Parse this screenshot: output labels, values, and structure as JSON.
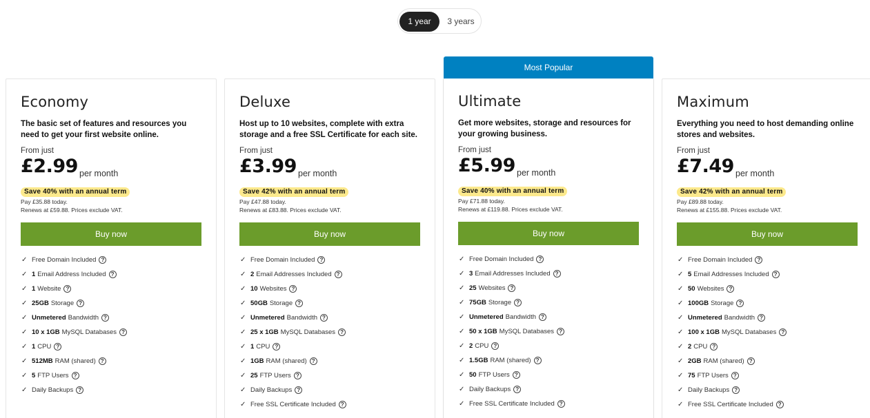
{
  "term_toggle": {
    "option_1": "1 year",
    "option_2": "3 years"
  },
  "popular_label": "Most Popular",
  "plans": [
    {
      "name": "Economy",
      "description": "The basic set of features and resources you need to get your first website online.",
      "from_label": "From just",
      "price": "£2.99",
      "per": "per month",
      "save": "Save 40% with an annual term",
      "pay_today": "Pay £35.88 today.",
      "renews": "Renews at £59.88. Prices exclude VAT.",
      "buy": "Buy now",
      "features": [
        {
          "bold": "",
          "text": "Free Domain Included"
        },
        {
          "bold": "1",
          "text": "Email Address Included"
        },
        {
          "bold": "1",
          "text": "Website"
        },
        {
          "bold": "25GB",
          "text": "Storage"
        },
        {
          "bold": "Unmetered",
          "text": "Bandwidth"
        },
        {
          "bold": "10 x 1GB",
          "text": "MySQL Databases"
        },
        {
          "bold": "1",
          "text": "CPU"
        },
        {
          "bold": "512MB",
          "text": "RAM (shared)"
        },
        {
          "bold": "5",
          "text": "FTP Users"
        },
        {
          "bold": "",
          "text": "Daily Backups"
        }
      ]
    },
    {
      "name": "Deluxe",
      "description": "Host up to 10 websites, complete with extra storage and a free SSL Certificate for each site.",
      "from_label": "From just",
      "price": "£3.99",
      "per": "per month",
      "save": "Save 42% with an annual term",
      "pay_today": "Pay £47.88 today.",
      "renews": "Renews at £83.88. Prices exclude VAT.",
      "buy": "Buy now",
      "features": [
        {
          "bold": "",
          "text": "Free Domain Included"
        },
        {
          "bold": "2",
          "text": "Email Addresses Included"
        },
        {
          "bold": "10",
          "text": "Websites"
        },
        {
          "bold": "50GB",
          "text": "Storage"
        },
        {
          "bold": "Unmetered",
          "text": "Bandwidth"
        },
        {
          "bold": "25 x 1GB",
          "text": "MySQL Databases"
        },
        {
          "bold": "1",
          "text": "CPU"
        },
        {
          "bold": "1GB",
          "text": "RAM (shared)"
        },
        {
          "bold": "25",
          "text": "FTP Users"
        },
        {
          "bold": "",
          "text": "Daily Backups"
        },
        {
          "bold": "",
          "text": "Free SSL Certificate Included"
        }
      ]
    },
    {
      "name": "Ultimate",
      "description": "Get more websites, storage and resources for your growing business.",
      "from_label": "From just",
      "price": "£5.99",
      "per": "per month",
      "save": "Save 40% with an annual term",
      "pay_today": "Pay £71.88 today.",
      "renews": "Renews at £119.88. Prices exclude VAT.",
      "buy": "Buy now",
      "features": [
        {
          "bold": "",
          "text": "Free Domain Included"
        },
        {
          "bold": "3",
          "text": "Email Addresses Included"
        },
        {
          "bold": "25",
          "text": "Websites"
        },
        {
          "bold": "75GB",
          "text": "Storage"
        },
        {
          "bold": "Unmetered",
          "text": "Bandwidth"
        },
        {
          "bold": "50 x 1GB",
          "text": "MySQL Databases"
        },
        {
          "bold": "2",
          "text": "CPU"
        },
        {
          "bold": "1.5GB",
          "text": "RAM (shared)"
        },
        {
          "bold": "50",
          "text": "FTP Users"
        },
        {
          "bold": "",
          "text": "Daily Backups"
        },
        {
          "bold": "",
          "text": "Free SSL Certificate Included"
        }
      ]
    },
    {
      "name": "Maximum",
      "description": "Everything you need to host demanding online stores and websites.",
      "from_label": "From just",
      "price": "£7.49",
      "per": "per month",
      "save": "Save 42% with an annual term",
      "pay_today": "Pay £89.88 today.",
      "renews": "Renews at £155.88. Prices exclude VAT.",
      "buy": "Buy now",
      "features": [
        {
          "bold": "",
          "text": "Free Domain Included"
        },
        {
          "bold": "5",
          "text": "Email Addresses Included"
        },
        {
          "bold": "50",
          "text": "Websites"
        },
        {
          "bold": "100GB",
          "text": "Storage"
        },
        {
          "bold": "Unmetered",
          "text": "Bandwidth"
        },
        {
          "bold": "100 x 1GB",
          "text": "MySQL Databases"
        },
        {
          "bold": "2",
          "text": "CPU"
        },
        {
          "bold": "2GB",
          "text": "RAM (shared)"
        },
        {
          "bold": "75",
          "text": "FTP Users"
        },
        {
          "bold": "",
          "text": "Daily Backups"
        },
        {
          "bold": "",
          "text": "Free SSL Certificate Included"
        }
      ]
    }
  ],
  "icons": {
    "check": "check-icon",
    "help": "question-circle-icon"
  },
  "colors": {
    "buy_button": "#6b9c2b",
    "popular_banner": "#0081c1",
    "save_badge": "#fce98c",
    "toggle_active": "#222222"
  }
}
